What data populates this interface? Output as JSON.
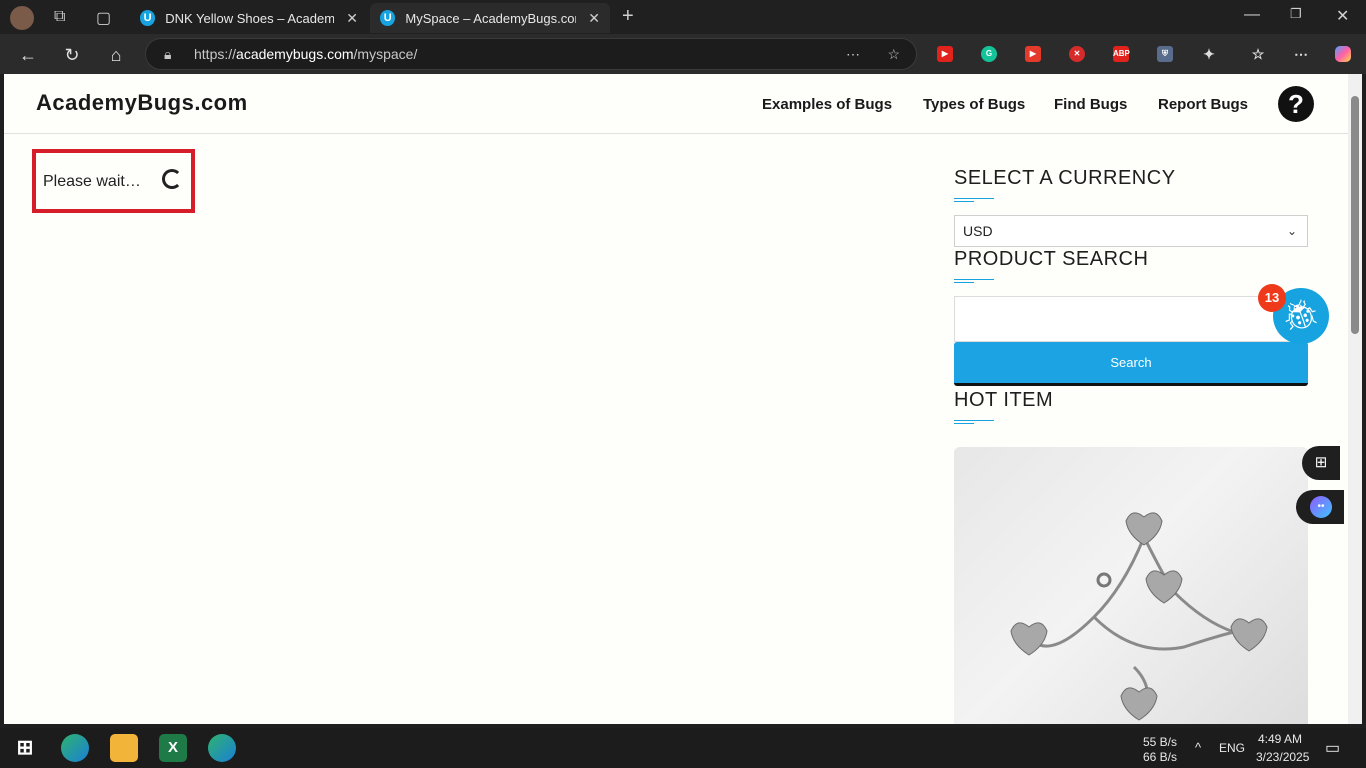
{
  "browser": {
    "tabs": [
      {
        "label": "DNK Yellow Shoes – AcademyBugs.com",
        "favicon": "U",
        "active": false
      },
      {
        "label": "MySpace – AcademyBugs.com",
        "favicon": "U",
        "active": true
      }
    ],
    "url_prefix": "https://",
    "url_host": "academybugs.com",
    "url_path": "/myspace/"
  },
  "site": {
    "logo": "AcademyBugs.com",
    "nav": [
      "Examples of Bugs",
      "Types of Bugs",
      "Find Bugs",
      "Report Bugs"
    ],
    "help_icon": "?"
  },
  "loading": {
    "text": "Please wait…"
  },
  "sidebar": {
    "currency_heading": "SELECT A CURRENCY",
    "currency_value": "USD",
    "search_heading": "PRODUCT SEARCH",
    "search_button": "Search",
    "hot_heading": "HOT ITEM"
  },
  "bug_widget": {
    "count": "13"
  },
  "taskbar": {
    "net_down": "55 B/s",
    "net_up": "66 B/s",
    "lang": "ENG",
    "time": "4:49 AM",
    "date": "3/23/2025"
  },
  "colors": {
    "accent": "#16a3e0",
    "highlight_border": "#d61d2a",
    "badge": "#ee3a1a"
  }
}
